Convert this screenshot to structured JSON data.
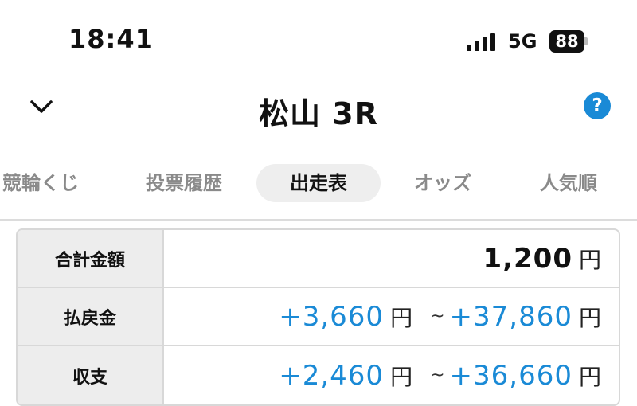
{
  "status": {
    "time": "18:41",
    "network": "5G",
    "battery": "88"
  },
  "nav": {
    "title": "松山 3R",
    "help": "?"
  },
  "tabs": [
    {
      "label": "競輪くじ",
      "active": false
    },
    {
      "label": "投票履歴",
      "active": false
    },
    {
      "label": "出走表",
      "active": true
    },
    {
      "label": "オッズ",
      "active": false
    },
    {
      "label": "人気順",
      "active": false
    }
  ],
  "summary": {
    "total": {
      "label": "合計金額",
      "amount": "1,200",
      "unit": "円"
    },
    "payout": {
      "label": "払戻金",
      "min": "+3,660",
      "tilde": "~",
      "max": "+37,860",
      "unit": "円"
    },
    "balance": {
      "label": "収支",
      "min": "+2,460",
      "tilde": "~",
      "max": "+36,660",
      "unit": "円"
    }
  },
  "colors": {
    "accent": "#1a8ad6"
  }
}
